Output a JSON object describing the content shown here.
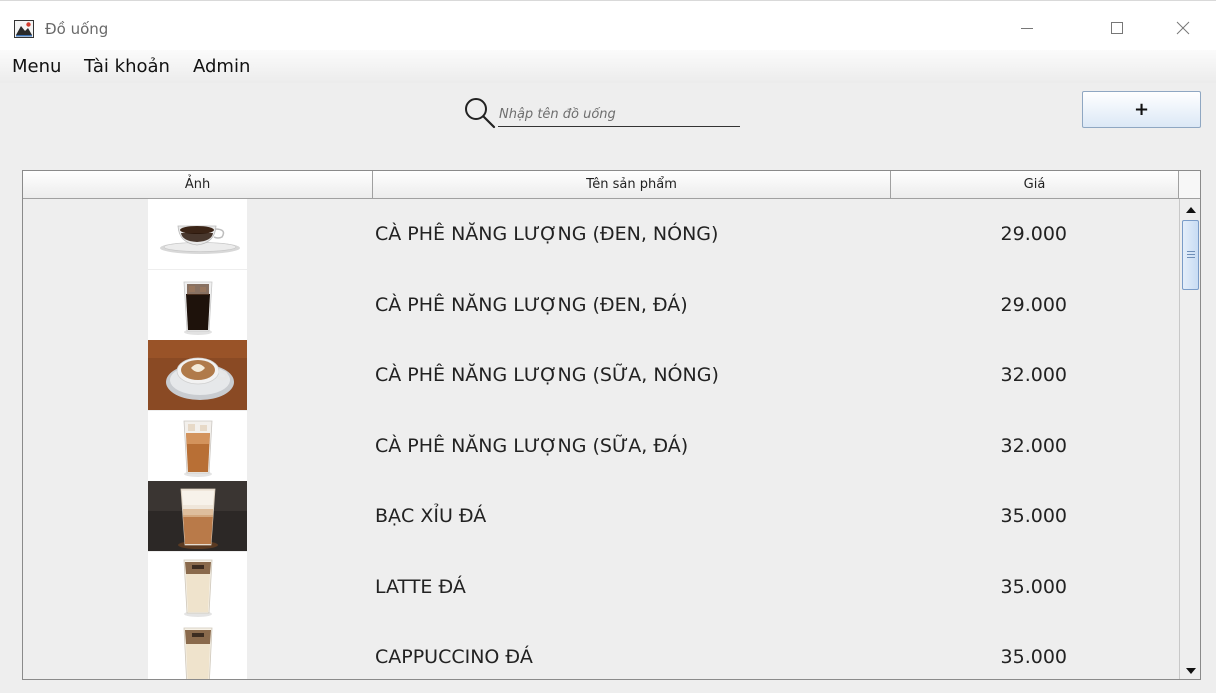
{
  "window": {
    "title": "Đồ uống",
    "controls": {
      "minimize": "─",
      "maximize": "☐",
      "close": "✕"
    }
  },
  "menubar": {
    "items": [
      "Menu",
      "Tài khoản",
      "Admin"
    ]
  },
  "search": {
    "placeholder": "Nhập tên đồ uống",
    "value": "",
    "icon": "search-icon"
  },
  "add_button": {
    "label": "+"
  },
  "table": {
    "columns": [
      "Ảnh",
      "Tên sản phẩm",
      "Giá"
    ],
    "rows": [
      {
        "image": "hot-black-coffee-glass-cup",
        "name": "CÀ PHÊ NĂNG LƯỢNG (ĐEN, NÓNG)",
        "price": "29.000"
      },
      {
        "image": "iced-black-coffee-glass",
        "name": "CÀ PHÊ NĂNG LƯỢNG (ĐEN, ĐÁ)",
        "price": "29.000"
      },
      {
        "image": "hot-milk-coffee-latte-art",
        "name": "CÀ PHÊ NĂNG LƯỢNG (SỮA, NÓNG)",
        "price": "32.000"
      },
      {
        "image": "iced-milk-coffee-glass",
        "name": "CÀ PHÊ NĂNG LƯỢNG (SỮA, ĐÁ)",
        "price": "32.000"
      },
      {
        "image": "bac-xiu-iced-glass",
        "name": "BẠC XỈU ĐÁ",
        "price": "35.000"
      },
      {
        "image": "iced-latte-glass",
        "name": "LATTE ĐÁ",
        "price": "35.000"
      },
      {
        "image": "iced-cappuccino-glass",
        "name": "CAPPUCCINO ĐÁ",
        "price": "35.000"
      }
    ]
  },
  "scrollbar": {
    "position_fraction": 0.0
  }
}
